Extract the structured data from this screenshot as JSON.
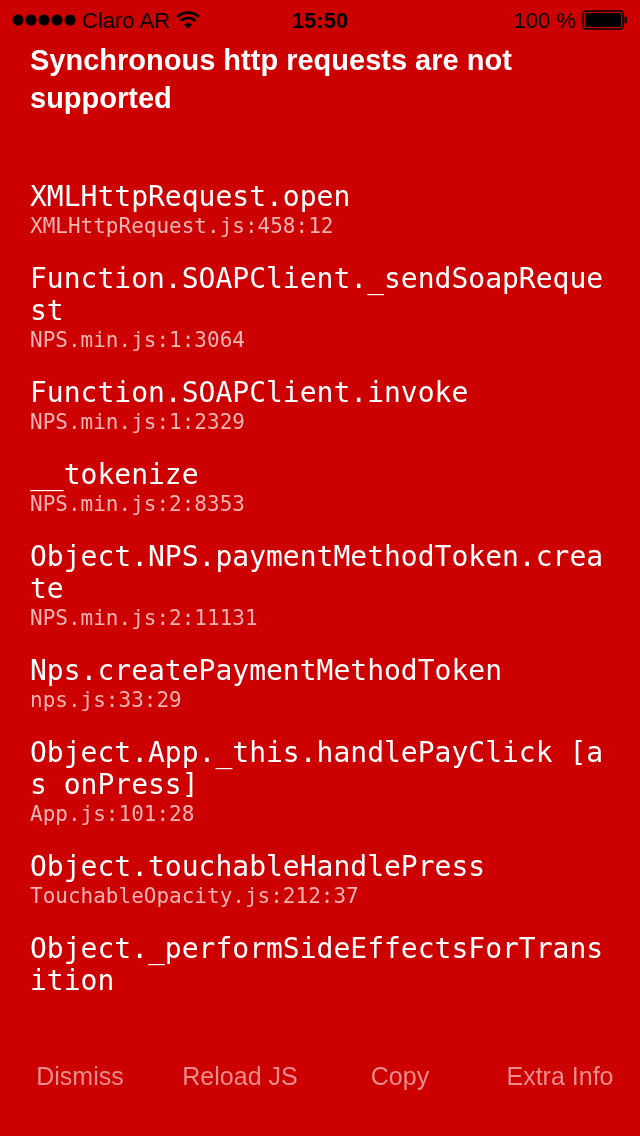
{
  "status_bar": {
    "carrier": "Claro AR",
    "time": "15:50",
    "battery": "100 %"
  },
  "title": "Synchronous http requests are not supported",
  "stack": [
    {
      "method": "XMLHttpRequest.open",
      "location": "XMLHttpRequest.js:458:12"
    },
    {
      "method": "Function.SOAPClient._sendSoapRequest",
      "location": "NPS.min.js:1:3064"
    },
    {
      "method": "Function.SOAPClient.invoke",
      "location": "NPS.min.js:1:2329"
    },
    {
      "method": "__tokenize",
      "location": "NPS.min.js:2:8353"
    },
    {
      "method": "Object.NPS.paymentMethodToken.create",
      "location": "NPS.min.js:2:11131"
    },
    {
      "method": "Nps.createPaymentMethodToken",
      "location": "nps.js:33:29"
    },
    {
      "method": "Object.App._this.handlePayClick [as onPress]",
      "location": "App.js:101:28"
    },
    {
      "method": "Object.touchableHandlePress",
      "location": "TouchableOpacity.js:212:37"
    },
    {
      "method": "Object._performSideEffectsForTransition"
    }
  ],
  "buttons": [
    "Dismiss",
    "Reload JS",
    "Copy",
    "Extra Info"
  ]
}
